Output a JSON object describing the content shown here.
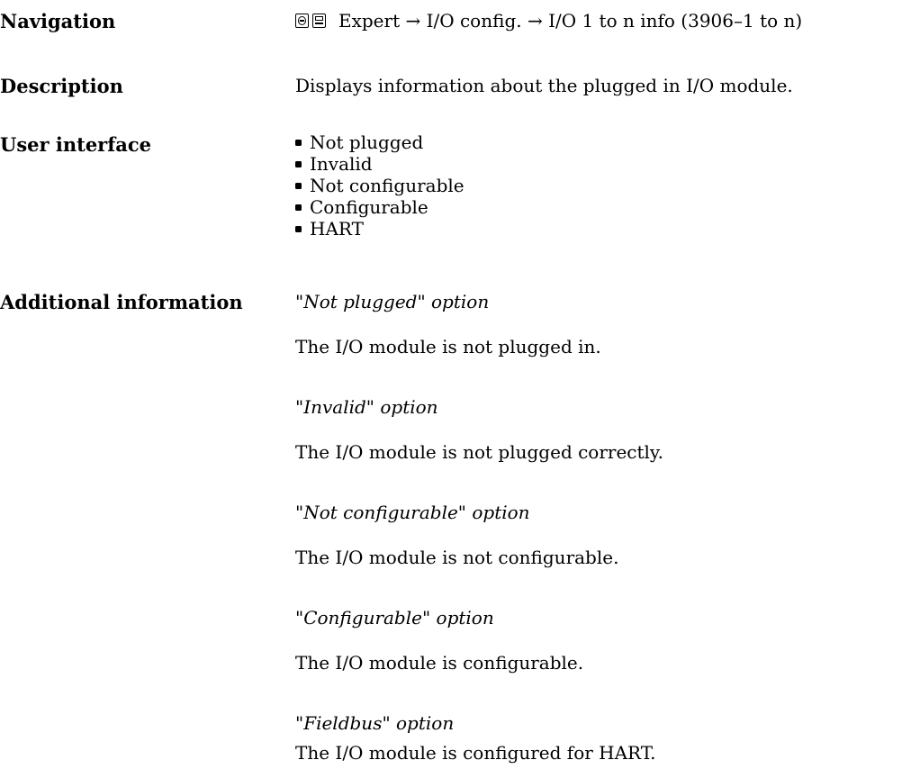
{
  "navigation": {
    "label": "Navigation",
    "path": "Expert → I/O config. → I/O 1 to n info (3906–1 to n)"
  },
  "description": {
    "label": "Description",
    "text": "Displays information about the plugged in I/O module."
  },
  "user_interface": {
    "label": "User interface",
    "options": [
      "Not plugged",
      "Invalid",
      "Not configurable",
      "Configurable",
      "HART"
    ]
  },
  "additional_information": {
    "label": "Additional information",
    "items": [
      {
        "heading": "\"Not plugged\" option",
        "text": "The I/O module is not plugged in."
      },
      {
        "heading": "\"Invalid\" option",
        "text": "The I/O module is not plugged correctly."
      },
      {
        "heading": "\"Not configurable\" option",
        "text": "The I/O module is not configurable."
      },
      {
        "heading": "\"Configurable\" option",
        "text": "The I/O module is configurable."
      },
      {
        "heading": "\"Fieldbus\" option",
        "text": "The I/O module is configured for HART."
      }
    ]
  }
}
